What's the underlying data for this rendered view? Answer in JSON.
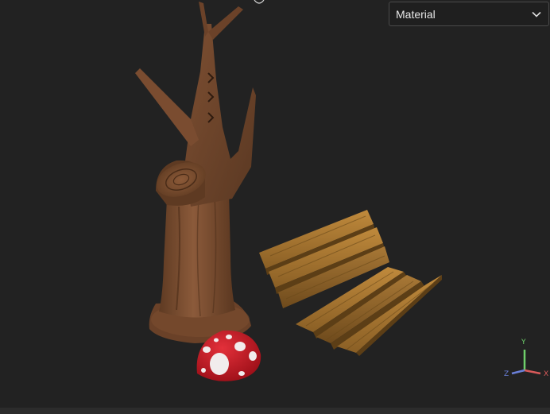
{
  "view_mode_dropdown": {
    "selected": "Material"
  },
  "axis_gizmo": {
    "y_label": "Y",
    "z_label": "Z",
    "x_label": "X",
    "y_color": "#6fd06b",
    "z_color": "#6a7fd8",
    "x_color": "#d85a5a"
  },
  "scene": {
    "objects": [
      "tree-stump",
      "park-bench",
      "mushroom"
    ]
  }
}
